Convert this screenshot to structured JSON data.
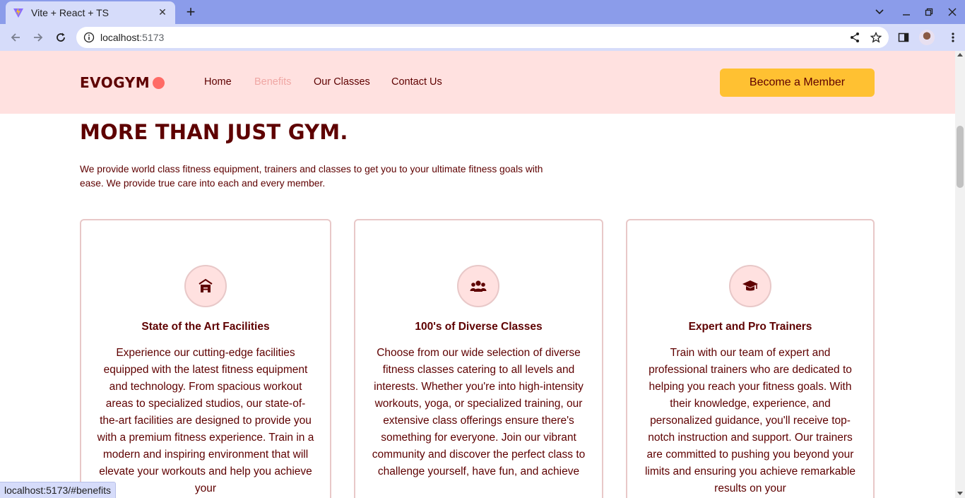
{
  "browser": {
    "tab_title": "Vite + React + TS",
    "tab_close": "✕",
    "new_tab": "+",
    "url_host": "localhost",
    "url_port": ":5173",
    "status_url": "localhost:5173/#benefits"
  },
  "navbar": {
    "logo": "EVOGYM",
    "links": [
      {
        "label": "Home",
        "active": false
      },
      {
        "label": "Benefits",
        "active": true
      },
      {
        "label": "Our Classes",
        "active": false
      },
      {
        "label": "Contact Us",
        "active": false
      }
    ],
    "cta_label": "Become a Member"
  },
  "benefits": {
    "heading": "MORE THAN JUST GYM.",
    "intro": "We provide world class fitness equipment, trainers and classes to get you to your ultimate fitness goals with ease. We provide true care into each and every member.",
    "cards": [
      {
        "icon": "gym-building-icon",
        "title": "State of the Art Facilities",
        "text": "Experience our cutting-edge facilities equipped with the latest fitness equipment and technology. From spacious workout areas to specialized studios, our state-of-the-art facilities are designed to provide you with a premium fitness experience. Train in a modern and inspiring environment that will elevate your workouts and help you achieve your"
      },
      {
        "icon": "user-group-icon",
        "title": "100's of Diverse Classes",
        "text": "Choose from our wide selection of diverse fitness classes catering to all levels and interests. Whether you're into high-intensity workouts, yoga, or specialized training, our extensive class offerings ensure there's something for everyone. Join our vibrant community and discover the perfect class to challenge yourself, have fun, and achieve"
      },
      {
        "icon": "graduation-cap-icon",
        "title": "Expert and Pro Trainers",
        "text": "Train with our team of expert and professional trainers who are dedicated to helping you reach your fitness goals. With their knowledge, experience, and personalized guidance, you'll receive top-notch instruction and support. Our trainers are committed to pushing you beyond your limits and ensuring you achieve remarkable results on your"
      }
    ]
  },
  "colors": {
    "primary": "#5e0000",
    "nav_bg": "#ffe1e0",
    "accent": "#ffc132",
    "logo_dot": "#ff6b66",
    "active_link": "#f0a7a4"
  }
}
